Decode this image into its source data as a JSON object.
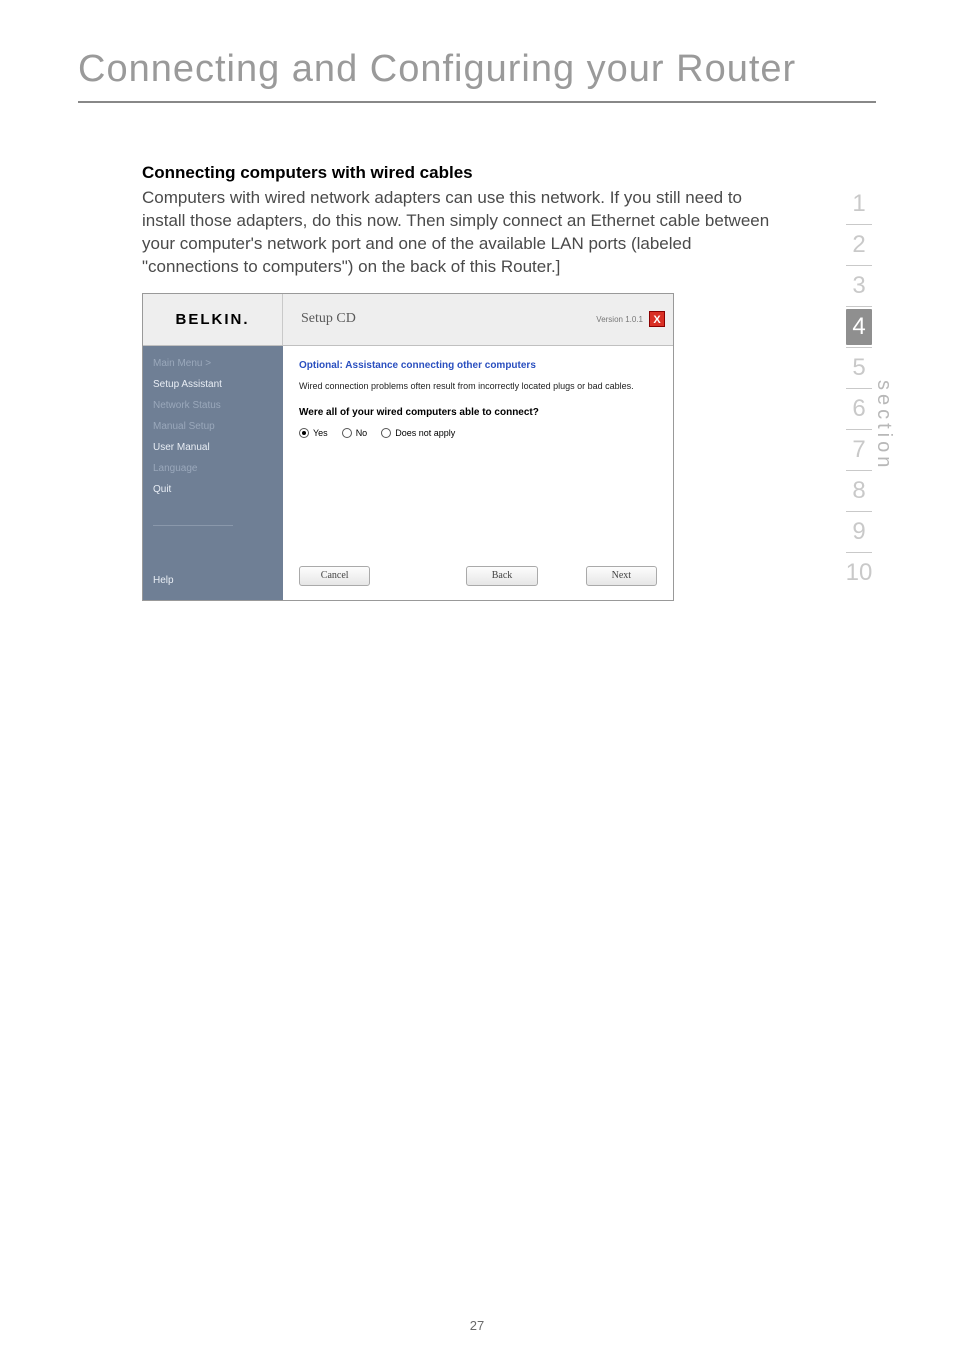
{
  "page": {
    "title": "Connecting and Configuring your Router",
    "number": "27"
  },
  "section": {
    "label": "section",
    "items": [
      "1",
      "2",
      "3",
      "4",
      "5",
      "6",
      "7",
      "8",
      "9",
      "10"
    ],
    "current": "4"
  },
  "content": {
    "subhead": "Connecting computers with wired cables",
    "body": "Computers with wired network adapters can use this network. If you still need to install those adapters, do this now. Then simply connect an Ethernet cable between your computer's network port and one of the available LAN ports (labeled \"connections to computers\") on the back of this Router.]"
  },
  "app": {
    "logo": "BELKIN.",
    "title": "Setup CD",
    "version": "Version 1.0.1",
    "close": "X",
    "sidebar": {
      "main_menu": "Main Menu  >",
      "setup_assistant": "Setup Assistant",
      "network_status": "Network Status",
      "manual_setup": "Manual Setup",
      "user_manual": "User Manual",
      "language": "Language",
      "quit": "Quit",
      "help": "Help"
    },
    "panel": {
      "head": "Optional: Assistance connecting other computers",
      "note": "Wired connection problems often result from incorrectly located plugs or bad cables.",
      "question": "Were all of your wired computers able to connect?",
      "opt_yes": "Yes",
      "opt_no": "No",
      "opt_dna": "Does not apply"
    },
    "buttons": {
      "cancel": "Cancel",
      "back": "Back",
      "next": "Next"
    }
  }
}
